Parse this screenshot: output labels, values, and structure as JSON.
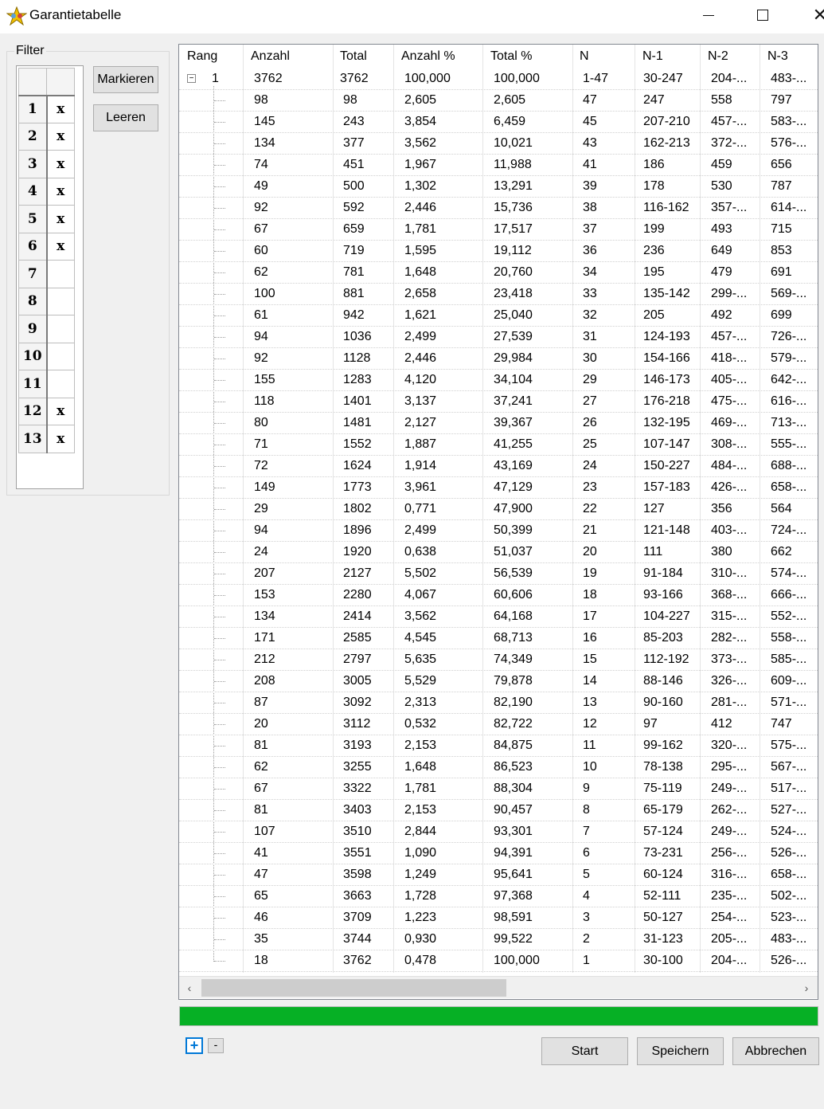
{
  "window": {
    "title": "Garantietabelle",
    "close_glyph": "✕"
  },
  "filter": {
    "legend": "Filter",
    "rows": [
      {
        "num": "1",
        "mark": "x"
      },
      {
        "num": "2",
        "mark": "x"
      },
      {
        "num": "3",
        "mark": "x"
      },
      {
        "num": "4",
        "mark": "x"
      },
      {
        "num": "5",
        "mark": "x"
      },
      {
        "num": "6",
        "mark": "x"
      },
      {
        "num": "7",
        "mark": ""
      },
      {
        "num": "8",
        "mark": ""
      },
      {
        "num": "9",
        "mark": ""
      },
      {
        "num": "10",
        "mark": ""
      },
      {
        "num": "11",
        "mark": ""
      },
      {
        "num": "12",
        "mark": "x"
      },
      {
        "num": "13",
        "mark": "x"
      }
    ],
    "mark_button": "Markieren",
    "clear_button": "Leeren"
  },
  "table": {
    "columns": [
      "Rang",
      "Anzahl",
      "Total",
      "Anzahl %",
      "Total %",
      "N",
      "N-1",
      "N-2",
      "N-3"
    ],
    "root": {
      "rang": "1",
      "expand_glyph": "−",
      "anzahl": "3762",
      "total": "3762",
      "anzahl_pct": "100,000",
      "total_pct": "100,000",
      "n": "1-47",
      "n1": "30-247",
      "n2": "204-...",
      "n3": "483-..."
    },
    "rows": [
      [
        "98",
        "98",
        "2,605",
        "2,605",
        "47",
        "247",
        "558",
        "797"
      ],
      [
        "145",
        "243",
        "3,854",
        "6,459",
        "45",
        "207-210",
        "457-...",
        "583-..."
      ],
      [
        "134",
        "377",
        "3,562",
        "10,021",
        "43",
        "162-213",
        "372-...",
        "576-..."
      ],
      [
        "74",
        "451",
        "1,967",
        "11,988",
        "41",
        "186",
        "459",
        "656"
      ],
      [
        "49",
        "500",
        "1,302",
        "13,291",
        "39",
        "178",
        "530",
        "787"
      ],
      [
        "92",
        "592",
        "2,446",
        "15,736",
        "38",
        "116-162",
        "357-...",
        "614-..."
      ],
      [
        "67",
        "659",
        "1,781",
        "17,517",
        "37",
        "199",
        "493",
        "715"
      ],
      [
        "60",
        "719",
        "1,595",
        "19,112",
        "36",
        "236",
        "649",
        "853"
      ],
      [
        "62",
        "781",
        "1,648",
        "20,760",
        "34",
        "195",
        "479",
        "691"
      ],
      [
        "100",
        "881",
        "2,658",
        "23,418",
        "33",
        "135-142",
        "299-...",
        "569-..."
      ],
      [
        "61",
        "942",
        "1,621",
        "25,040",
        "32",
        "205",
        "492",
        "699"
      ],
      [
        "94",
        "1036",
        "2,499",
        "27,539",
        "31",
        "124-193",
        "457-...",
        "726-..."
      ],
      [
        "92",
        "1128",
        "2,446",
        "29,984",
        "30",
        "154-166",
        "418-...",
        "579-..."
      ],
      [
        "155",
        "1283",
        "4,120",
        "34,104",
        "29",
        "146-173",
        "405-...",
        "642-..."
      ],
      [
        "118",
        "1401",
        "3,137",
        "37,241",
        "27",
        "176-218",
        "475-...",
        "616-..."
      ],
      [
        "80",
        "1481",
        "2,127",
        "39,367",
        "26",
        "132-195",
        "469-...",
        "713-..."
      ],
      [
        "71",
        "1552",
        "1,887",
        "41,255",
        "25",
        "107-147",
        "308-...",
        "555-..."
      ],
      [
        "72",
        "1624",
        "1,914",
        "43,169",
        "24",
        "150-227",
        "484-...",
        "688-..."
      ],
      [
        "149",
        "1773",
        "3,961",
        "47,129",
        "23",
        "157-183",
        "426-...",
        "658-..."
      ],
      [
        "29",
        "1802",
        "0,771",
        "47,900",
        "22",
        "127",
        "356",
        "564"
      ],
      [
        "94",
        "1896",
        "2,499",
        "50,399",
        "21",
        "121-148",
        "403-...",
        "724-..."
      ],
      [
        "24",
        "1920",
        "0,638",
        "51,037",
        "20",
        "111",
        "380",
        "662"
      ],
      [
        "207",
        "2127",
        "5,502",
        "56,539",
        "19",
        "91-184",
        "310-...",
        "574-..."
      ],
      [
        "153",
        "2280",
        "4,067",
        "60,606",
        "18",
        "93-166",
        "368-...",
        "666-..."
      ],
      [
        "134",
        "2414",
        "3,562",
        "64,168",
        "17",
        "104-227",
        "315-...",
        "552-..."
      ],
      [
        "171",
        "2585",
        "4,545",
        "68,713",
        "16",
        "85-203",
        "282-...",
        "558-..."
      ],
      [
        "212",
        "2797",
        "5,635",
        "74,349",
        "15",
        "112-192",
        "373-...",
        "585-..."
      ],
      [
        "208",
        "3005",
        "5,529",
        "79,878",
        "14",
        "88-146",
        "326-...",
        "609-..."
      ],
      [
        "87",
        "3092",
        "2,313",
        "82,190",
        "13",
        "90-160",
        "281-...",
        "571-..."
      ],
      [
        "20",
        "3112",
        "0,532",
        "82,722",
        "12",
        "97",
        "412",
        "747"
      ],
      [
        "81",
        "3193",
        "2,153",
        "84,875",
        "11",
        "99-162",
        "320-...",
        "575-..."
      ],
      [
        "62",
        "3255",
        "1,648",
        "86,523",
        "10",
        "78-138",
        "295-...",
        "567-..."
      ],
      [
        "67",
        "3322",
        "1,781",
        "88,304",
        "9",
        "75-119",
        "249-...",
        "517-..."
      ],
      [
        "81",
        "3403",
        "2,153",
        "90,457",
        "8",
        "65-179",
        "262-...",
        "527-..."
      ],
      [
        "107",
        "3510",
        "2,844",
        "93,301",
        "7",
        "57-124",
        "249-...",
        "524-..."
      ],
      [
        "41",
        "3551",
        "1,090",
        "94,391",
        "6",
        "73-231",
        "256-...",
        "526-..."
      ],
      [
        "47",
        "3598",
        "1,249",
        "95,641",
        "5",
        "60-124",
        "316-...",
        "658-..."
      ],
      [
        "65",
        "3663",
        "1,728",
        "97,368",
        "4",
        "52-111",
        "235-...",
        "502-..."
      ],
      [
        "46",
        "3709",
        "1,223",
        "98,591",
        "3",
        "50-127",
        "254-...",
        "523-..."
      ],
      [
        "35",
        "3744",
        "0,930",
        "99,522",
        "2",
        "31-123",
        "205-...",
        "483-..."
      ],
      [
        "18",
        "3762",
        "0,478",
        "100,000",
        "1",
        "30-100",
        "204-...",
        "526-..."
      ]
    ]
  },
  "scrollbar": {
    "left_glyph": "‹",
    "right_glyph": "›"
  },
  "progress": {
    "value_fraction": 1.0
  },
  "tree_controls": {
    "plus": "+",
    "minus": "-"
  },
  "actions": {
    "start": "Start",
    "save": "Speichern",
    "cancel": "Abbrechen"
  }
}
